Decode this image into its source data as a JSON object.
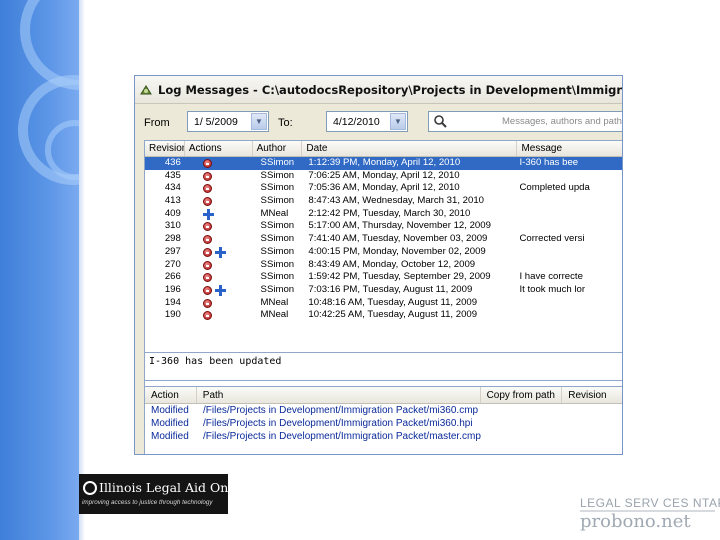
{
  "window": {
    "title": "Log Messages - C:\\autodocsRepository\\Projects in Development\\Immigration Packet"
  },
  "filter": {
    "from_label": "From",
    "from_value": "1/ 5/2009",
    "to_label": "To:",
    "to_value": "4/12/2010",
    "search_placeholder": "Messages, authors and path"
  },
  "log_table": {
    "columns": [
      "Revision",
      "Actions",
      "Author",
      "Date",
      "Message"
    ],
    "rows": [
      {
        "revision": "436",
        "author": "SSimon",
        "date": "1:12:39 PM, Monday, April 12, 2010",
        "message": "I-360 has bee",
        "selected": true,
        "icons": [
          "red"
        ]
      },
      {
        "revision": "435",
        "author": "SSimon",
        "date": "7:06:25 AM, Monday, April 12, 2010",
        "message": "",
        "icons": [
          "red"
        ]
      },
      {
        "revision": "434",
        "author": "SSimon",
        "date": "7:05:36 AM, Monday, April 12, 2010",
        "message": "Completed upda",
        "icons": [
          "red"
        ]
      },
      {
        "revision": "413",
        "author": "SSimon",
        "date": "8:47:43 AM, Wednesday, March 31, 2010",
        "message": "",
        "icons": [
          "red"
        ]
      },
      {
        "revision": "409",
        "author": "MNeal",
        "date": "2:12:42 PM, Tuesday, March 30, 2010",
        "message": "",
        "icons": [
          "blue"
        ]
      },
      {
        "revision": "310",
        "author": "SSimon",
        "date": "5:17:00 AM, Thursday, November 12, 2009",
        "message": "",
        "icons": [
          "red"
        ]
      },
      {
        "revision": "298",
        "author": "SSimon",
        "date": "7:41:40 AM, Tuesday, November 03, 2009",
        "message": "Corrected versi",
        "icons": [
          "red"
        ]
      },
      {
        "revision": "297",
        "author": "SSimon",
        "date": "4:00:15 PM, Monday, November 02, 2009",
        "message": "",
        "icons": [
          "red",
          "blue"
        ]
      },
      {
        "revision": "270",
        "author": "SSimon",
        "date": "8:43:49 AM, Monday, October 12, 2009",
        "message": "",
        "icons": [
          "red"
        ]
      },
      {
        "revision": "266",
        "author": "SSimon",
        "date": "1:59:42 PM, Tuesday, September 29, 2009",
        "message": "I have correcte",
        "icons": [
          "red"
        ]
      },
      {
        "revision": "196",
        "author": "SSimon",
        "date": "7:03:16 PM, Tuesday, August 11, 2009",
        "message": "It took much lor",
        "icons": [
          "red",
          "blue"
        ]
      },
      {
        "revision": "194",
        "author": "MNeal",
        "date": "10:48:16 AM, Tuesday, August 11, 2009",
        "message": "",
        "icons": [
          "red"
        ]
      },
      {
        "revision": "190",
        "author": "MNeal",
        "date": "10:42:25 AM, Tuesday, August 11, 2009",
        "message": "",
        "icons": [
          "red"
        ]
      }
    ]
  },
  "message_text": "I-360 has been updated",
  "changed_paths": {
    "columns": [
      "Action",
      "Path",
      "Copy from path",
      "Revision"
    ],
    "rows": [
      {
        "action": "Modified",
        "path": "/Files/Projects in Development/Immigration Packet/mi360.cmp"
      },
      {
        "action": "Modified",
        "path": "/Files/Projects in Development/Immigration Packet/mi360.hpi"
      },
      {
        "action": "Modified",
        "path": "/Files/Projects in Development/Immigration Packet/master.cmp"
      }
    ]
  },
  "branding": {
    "left_name": "Illinois Legal Aid Online",
    "left_tagline": "improving access to justice through technology",
    "right_line1": "LEGAL SERV CES NTAP",
    "right_line2": "probono.net"
  },
  "colors": {
    "selection": "#316ac5",
    "band": "#4a87dd"
  }
}
